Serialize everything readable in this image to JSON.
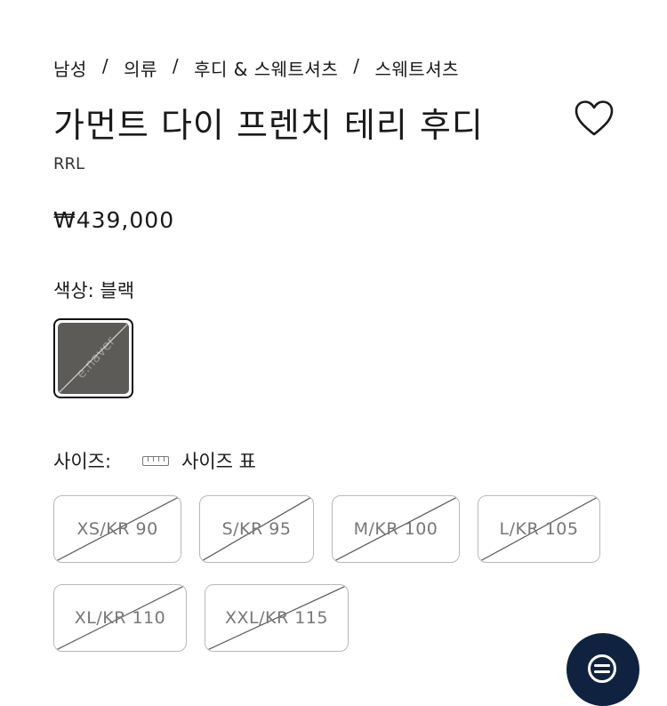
{
  "breadcrumb": [
    "남성",
    "의류",
    "후디 & 스웨트셔츠",
    "스웨트셔츠"
  ],
  "breadcrumb_separator": "/",
  "product": {
    "title": "가먼트 다이 프렌치 테리 후디",
    "brand": "RRL",
    "price": "₩439,000"
  },
  "color": {
    "label": "색상: 블랙",
    "swatch_hex": "#5d5b58",
    "watermark": "e.naver"
  },
  "size": {
    "label": "사이즈:",
    "chart_link": "사이즈 표",
    "options": [
      {
        "label": "XS/KR 90",
        "available": false
      },
      {
        "label": "S/KR 95",
        "available": false
      },
      {
        "label": "M/KR 100",
        "available": false
      },
      {
        "label": "L/KR 105",
        "available": false
      },
      {
        "label": "XL/KR 110",
        "available": false
      },
      {
        "label": "XXL/KR 115",
        "available": false
      }
    ]
  },
  "icons": {
    "wishlist": "heart-icon",
    "size_chart": "ruler-icon",
    "chat": "chat-icon"
  },
  "colors": {
    "text": "#1a1a1a",
    "disabled_text": "#777777",
    "border": "#b8b8b8",
    "chat_button": "#0f2340"
  }
}
